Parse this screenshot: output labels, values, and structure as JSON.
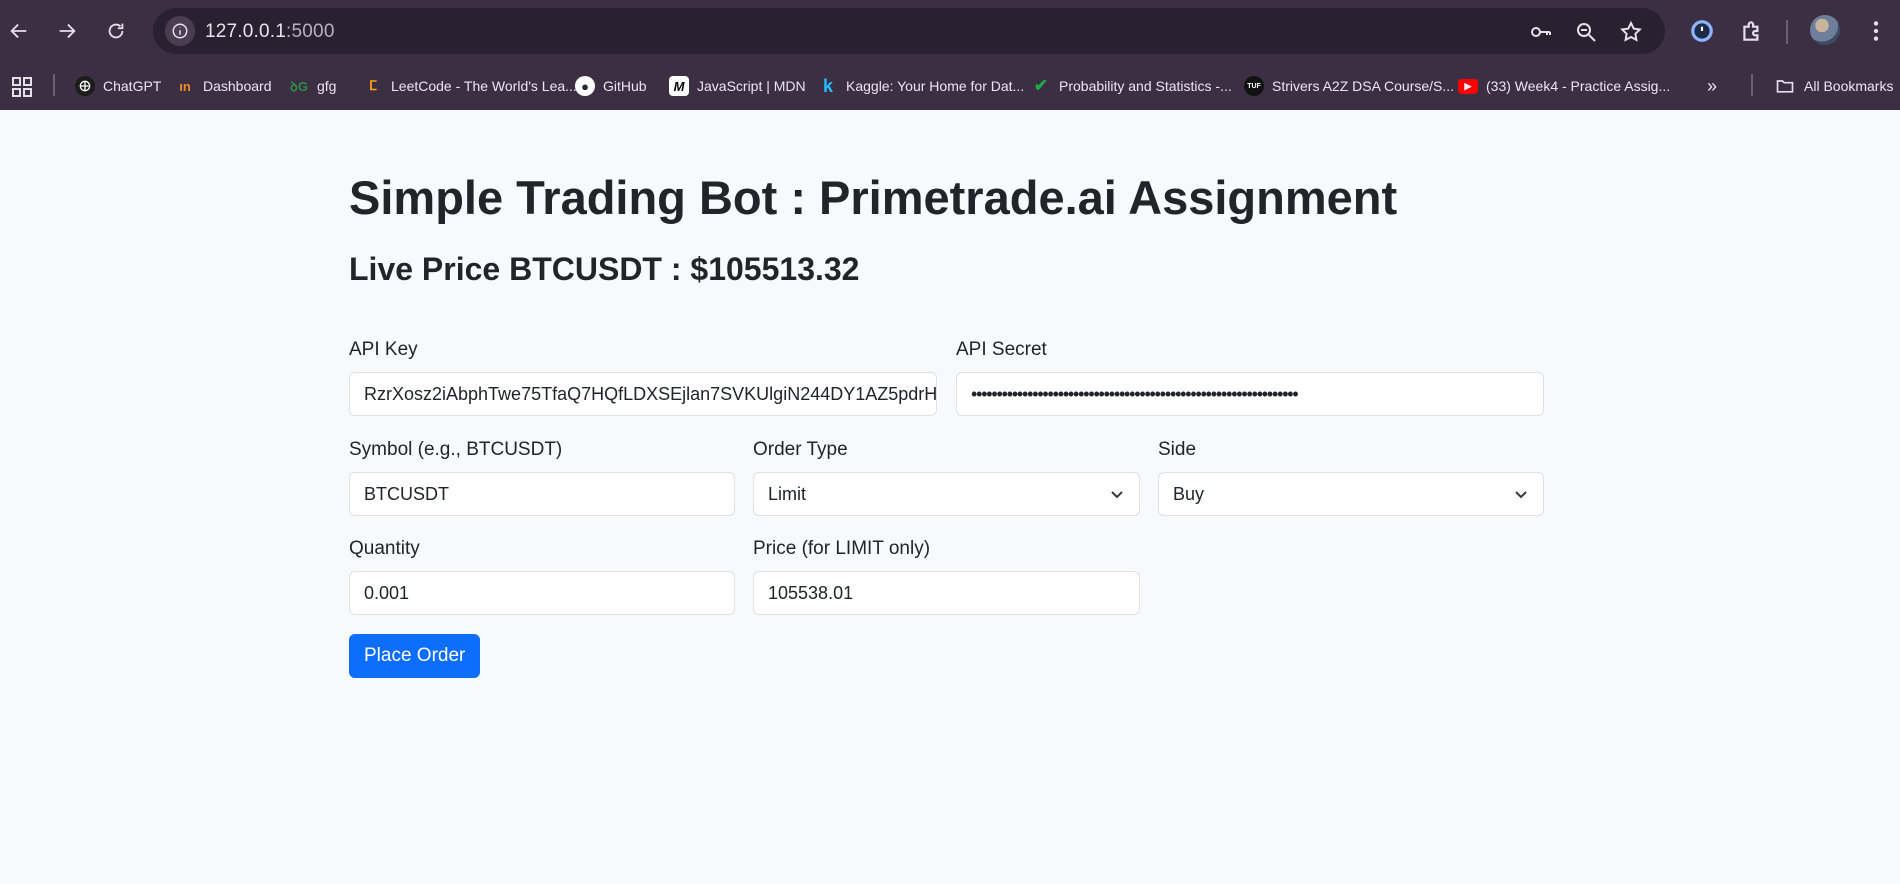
{
  "browser": {
    "url_host": "127.0.0.1",
    "url_port": ":5000",
    "bookmarks": [
      {
        "label": "ChatGPT",
        "icon": "chatgpt-icon"
      },
      {
        "label": "Dashboard",
        "icon": "dashboard-icon"
      },
      {
        "label": "gfg",
        "icon": "gfg-icon"
      },
      {
        "label": "LeetCode - The World's Lea...",
        "icon": "leetcode-icon"
      },
      {
        "label": "GitHub",
        "icon": "github-icon"
      },
      {
        "label": "JavaScript | MDN",
        "icon": "mdn-icon"
      },
      {
        "label": "Kaggle: Your Home for Dat...",
        "icon": "kaggle-icon"
      },
      {
        "label": "Probability and Statistics -...",
        "icon": "check-icon"
      },
      {
        "label": "Strivers A2Z DSA Course/S...",
        "icon": "tuf-icon"
      },
      {
        "label": "(33) Week4 - Practice Assig...",
        "icon": "youtube-icon"
      }
    ],
    "all_bookmarks_label": "All Bookmarks"
  },
  "page": {
    "title": "Simple Trading Bot : Primetrade.ai Assignment",
    "live_price": "Live Price BTCUSDT : $105513.32"
  },
  "form": {
    "api_key": {
      "label": "API Key",
      "value": "RzrXosz2iAbphTwe75TfaQ7HQfLDXSEjlan7SVKUlgiN244DY1AZ5pdrH"
    },
    "api_secret": {
      "label": "API Secret",
      "value": "••••••••••••••••••••••••••••••••••••••••••••••••••••••••••••••••"
    },
    "symbol": {
      "label": "Symbol (e.g., BTCUSDT)",
      "value": "BTCUSDT"
    },
    "order_type": {
      "label": "Order Type",
      "value": "Limit"
    },
    "side": {
      "label": "Side",
      "value": "Buy"
    },
    "quantity": {
      "label": "Quantity",
      "value": "0.001"
    },
    "price": {
      "label": "Price (for LIMIT only)",
      "value": "105538.01"
    },
    "submit_label": "Place Order"
  },
  "colors": {
    "primary": "#0d6efd",
    "browser_frame": "#3c2f44",
    "page_bg": "#f8f9fa"
  }
}
